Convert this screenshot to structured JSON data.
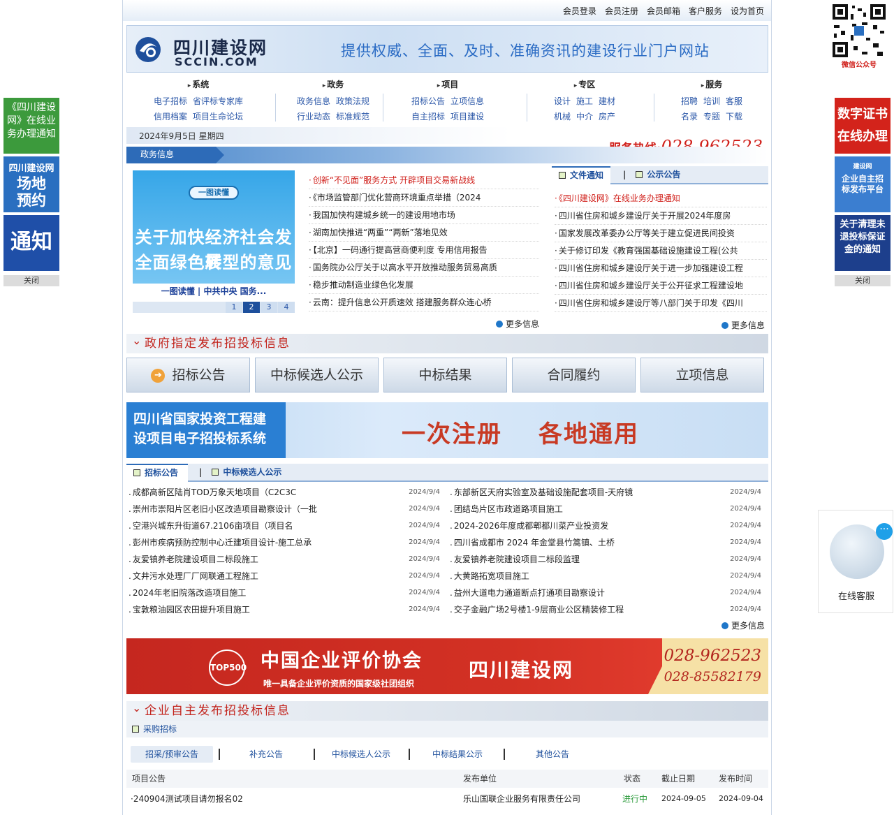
{
  "topbar": [
    "会员登录",
    "会员注册",
    "会员邮箱",
    "客户服务",
    "设为首页"
  ],
  "brand": {
    "cn": "四川建设网",
    "en": "SCCIN.COM",
    "slogan": "提供权威、全面、及时、准确资讯的建设行业门户网站"
  },
  "nav": [
    {
      "head": "系统",
      "rows": [
        [
          "电子招标",
          "省评标专家库"
        ],
        [
          "信用档案",
          "项目生命论坛"
        ]
      ]
    },
    {
      "head": "政务",
      "rows": [
        [
          "政务信息",
          "政策法规"
        ],
        [
          "行业动态",
          "标准规范"
        ]
      ]
    },
    {
      "head": "项目",
      "rows": [
        [
          "招标公告",
          "立项信息"
        ],
        [
          "自主招标",
          "项目建设"
        ]
      ]
    },
    {
      "head": "专区",
      "rows": [
        [
          "设计",
          "施工",
          "建材"
        ],
        [
          "机械",
          "中介",
          "房产"
        ]
      ]
    },
    {
      "head": "服务",
      "rows": [
        [
          "招聘",
          "培训",
          "客服"
        ],
        [
          "名录",
          "专题",
          "下载"
        ]
      ]
    }
  ],
  "date": "2024年9月5日 星期四",
  "hotline": {
    "label": "服务热线:",
    "number": "028-962523"
  },
  "gov": {
    "tab": "政务信息",
    "feature": {
      "pill": "一图读懂",
      "line1": "关于加快经济社会发展",
      "line2": "全面绿色转型的意见",
      "caption": "一图读懂 | 中共中央  国务..."
    },
    "pages": [
      "1",
      "2",
      "3",
      "4"
    ],
    "active_page": "2",
    "items": [
      "创新“不见面”服务方式  开辟项目交易新战线",
      "《市场监管部门优化营商环境重点举措（2024",
      "我国加快构建城乡统一的建设用地市场",
      "湖南加快推进“两重”“两新”落地见效",
      "【北京】一码通行提高营商便利度  专用信用报告",
      "国务院办公厅关于以高水平开放推动服务贸易高质",
      "稳步推动制造业绿色化发展",
      "云南：提升信息公开质速效  搭建服务群众连心桥"
    ],
    "more": "更多信息"
  },
  "files": {
    "tab_on": "文件通知",
    "tab_off": "公示公告",
    "items": [
      "《四川建设网》在线业务办理通知",
      "四川省住房和城乡建设厅关于开展2024年度房",
      "国家发展改革委办公厅等关于建立促进民间投资",
      "关于修订印发《教育强国基础设施建设工程(公共",
      "四川省住房和城乡建设厅关于进一步加强建设工程",
      "四川省住房和城乡建设厅关于公开征求工程建设地",
      "四川省住房和城乡建设厅等八部门关于印发《四川"
    ],
    "more": "更多信息"
  },
  "section1": "政府指定发布招投标信息",
  "buttons": [
    "招标公告",
    "中标候选人公示",
    "中标结果",
    "合同履约",
    "立项信息"
  ],
  "promo": {
    "left1": "四川省国家投资工程建",
    "left2": "设项目电子招投标系统",
    "r1": "一次注册",
    "r2": "各地通用"
  },
  "bid": {
    "tab_on": "招标公告",
    "tab_off": "中标候选人公示",
    "left": [
      [
        "成都高新区陆肖TOD万象天地项目（C2C3C",
        "2024/9/4"
      ],
      [
        "崇州市崇阳片区老旧小区改造项目勘察设计（一批",
        "2024/9/4"
      ],
      [
        "空港兴城东升街道67.2106亩项目（项目名",
        "2024/9/4"
      ],
      [
        "彭州市疾病预防控制中心迁建项目设计-施工总承",
        "2024/9/4"
      ],
      [
        "友爱镇养老院建设项目二标段施工",
        "2024/9/4"
      ],
      [
        "文井污水处理厂厂网联通工程施工",
        "2024/9/4"
      ],
      [
        "2024年老旧院落改造项目施工",
        "2024/9/4"
      ],
      [
        "宝敦粮油园区农田提升项目施工",
        "2024/9/4"
      ]
    ],
    "right": [
      [
        "东部新区天府实验室及基础设施配套项目-天府镜",
        "2024/9/4"
      ],
      [
        "团结岛片区市政道路项目施工",
        "2024/9/4"
      ],
      [
        "2024-2026年度成都郫都川菜产业投资发",
        "2024/9/4"
      ],
      [
        "四川省成都市 2024 年金堂县竹篙镇、土桥",
        "2024/9/4"
      ],
      [
        "友爱镇养老院建设项目二标段监理",
        "2024/9/4"
      ],
      [
        "大黄路拓宽项目施工",
        "2024/9/4"
      ],
      [
        "益州大道电力通道断点打通项目勘察设计",
        "2024/9/4"
      ],
      [
        "交子金融广场2号楼1-9层商业公区精装修工程",
        "2024/9/4"
      ]
    ],
    "more": "更多信息"
  },
  "ad2": {
    "top500": "TOP500",
    "t1": "中国企业评价协会",
    "t2": "唯一具备企业评价资质的国家级社团组织",
    "t3": "四川建设网",
    "p1": "028-962523",
    "p2": "028-85582179"
  },
  "section2": "企业自主发布招投标信息",
  "purchase": "采购招标",
  "subtabs": [
    "招采/预审公告",
    "补充公告",
    "中标候选人公示",
    "中标结果公示",
    "其他公告"
  ],
  "table": {
    "headers": [
      "项目公告",
      "发布单位",
      "状态",
      "截止日期",
      "发布时间"
    ],
    "row": [
      "·240904测试项目请勿报名02",
      "乐山国联企业服务有限责任公司",
      "进行中",
      "2024-09-05",
      "2024-09-04"
    ]
  },
  "left_float": {
    "b1": "《四川建设网》在线业务办理通知",
    "b2a": "四川建设网",
    "b2b": "场地预约",
    "b3": "通知",
    "close": "关闭"
  },
  "right_float": {
    "qr_caption": "微信公众号",
    "r1": "数字证书在线办理",
    "r2a": "建设网",
    "r2b": "企业自主招标发布平台",
    "r3": "关于清理未退投标保证金的通知",
    "close": "关闭"
  },
  "kefu": "在线客服"
}
